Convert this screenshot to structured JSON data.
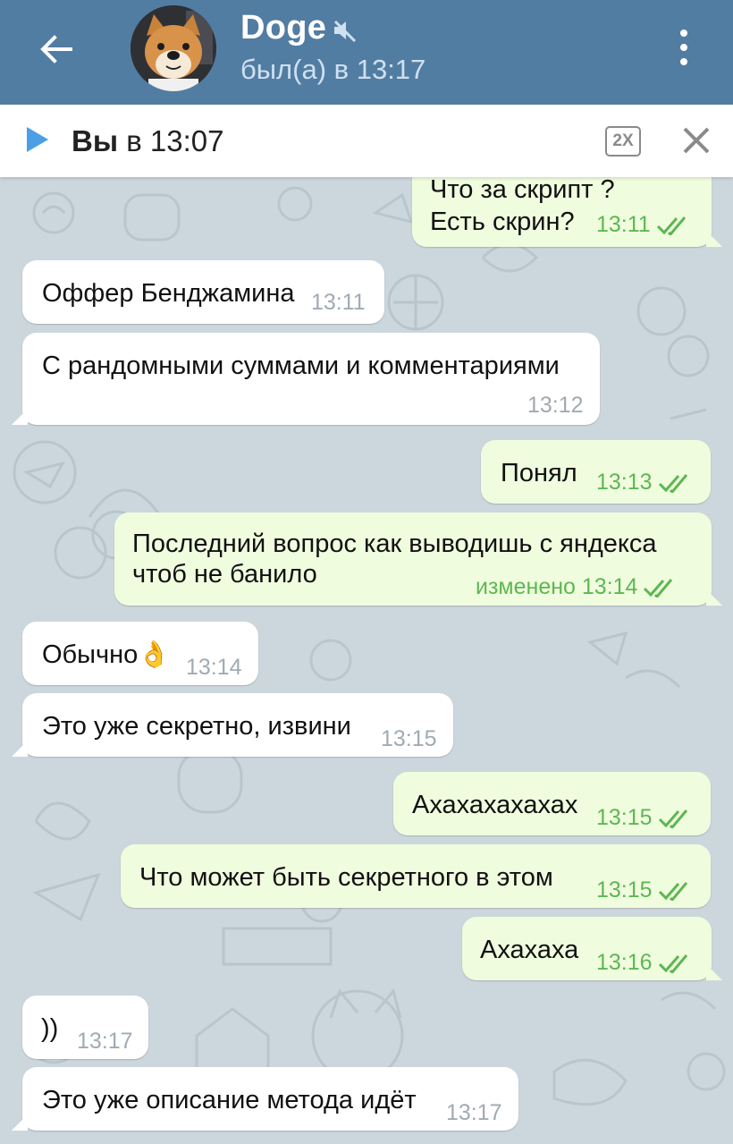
{
  "header": {
    "name": "Doge",
    "status": "был(а) в 13:17",
    "colors": {
      "bar": "#527da3",
      "status": "#cfe0f0"
    },
    "icons": [
      "back-arrow-icon",
      "avatar",
      "mute-icon",
      "more-vert-icon"
    ]
  },
  "player": {
    "name": "Вы",
    "time_prefix": "в 13:07",
    "speed": "2X",
    "icons": [
      "play-icon",
      "close-icon"
    ]
  },
  "messages": [
    {
      "dir": "out",
      "text": "Что за скрипт ?\nЕсть скрин?",
      "time": "13:11",
      "read": true
    },
    {
      "dir": "in",
      "text": "Оффер Бенджамина",
      "time": "13:11"
    },
    {
      "dir": "in",
      "text": "С рандомными суммами и комментариями",
      "time": "13:12"
    },
    {
      "dir": "out",
      "text": "Понял",
      "time": "13:13",
      "read": true
    },
    {
      "dir": "out",
      "text": "Последний вопрос как выводишь с яндекса\nчтоб не банило",
      "time": "изменено 13:14",
      "read": true
    },
    {
      "dir": "in",
      "text": "Обычно👌",
      "time": "13:14"
    },
    {
      "dir": "in",
      "text": "Это уже секретно, извини",
      "time": "13:15"
    },
    {
      "dir": "out",
      "text": "Ахахахахахах",
      "time": "13:15",
      "read": true
    },
    {
      "dir": "out",
      "text": "Что может быть секретного в этом",
      "time": "13:15",
      "read": true
    },
    {
      "dir": "out",
      "text": "Ахахаха",
      "time": "13:16",
      "read": true
    },
    {
      "dir": "in",
      "text": "))",
      "time": "13:17"
    },
    {
      "dir": "in",
      "text": "Это уже описание метода идёт",
      "time": "13:17"
    }
  ],
  "colors": {
    "chat_background": "#ccd7dd",
    "incoming_bubble": "#ffffff",
    "outgoing_bubble": "#effdde",
    "outgoing_meta": "#5fb653",
    "incoming_meta": "#a1aab3"
  }
}
